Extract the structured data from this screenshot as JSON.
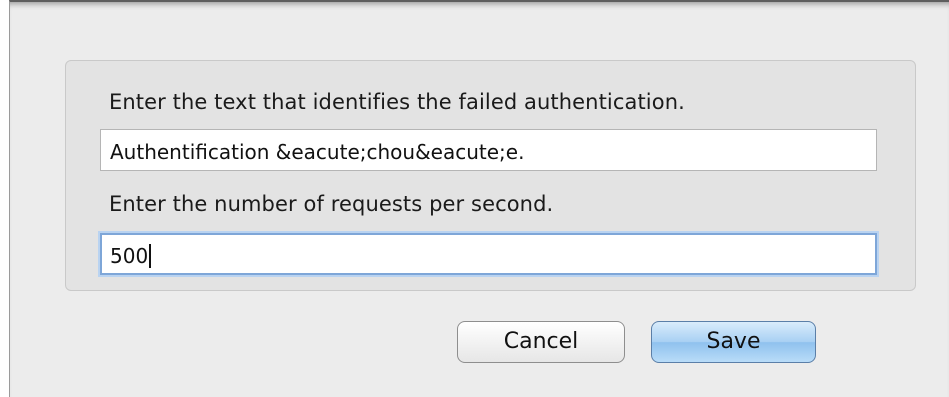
{
  "dialog": {
    "failed_auth_label": "Enter the text that identifies the failed authentication.",
    "failed_auth_value": "Authentification &eacute;chou&eacute;e.",
    "requests_label": "Enter the number of requests per second.",
    "requests_value": "500"
  },
  "buttons": {
    "cancel_label": "Cancel",
    "save_label": "Save"
  },
  "colors": {
    "sheet_background": "#ececec",
    "group_background": "#e3e3e3",
    "focus_ring": "#7ea6d8",
    "default_button": "#a8d0f3"
  }
}
